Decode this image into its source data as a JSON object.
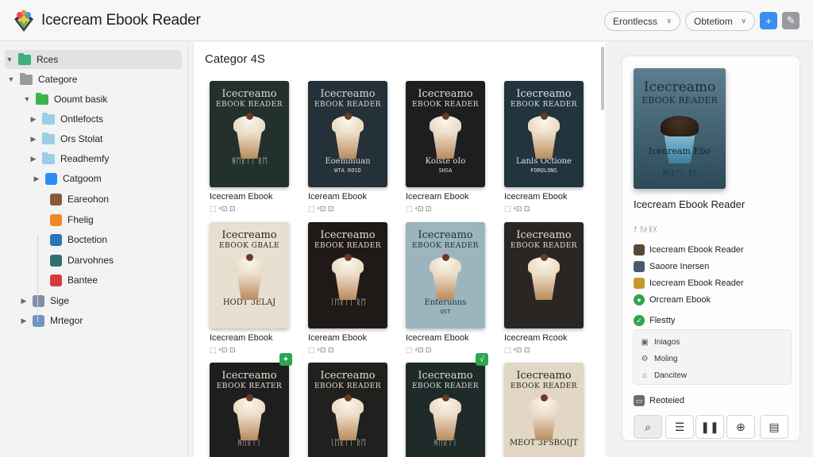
{
  "app": {
    "title": "Icecream Ebook Reader",
    "select_1": "Erontlecss",
    "select_2": "Obtetiom"
  },
  "sidebar": {
    "items": [
      {
        "label": "Rces",
        "depth": 0,
        "caret": "▼",
        "icon": "green-folder-icon",
        "color": "#3fae7a"
      },
      {
        "label": "Categore",
        "depth": 0,
        "caret": "▼",
        "icon": "category-folder-icon",
        "color": "#9a9a9e"
      },
      {
        "label": "Ooumt basik",
        "depth": 1,
        "caret": "▼",
        "icon": "green-folder-icon",
        "color": "#39b54a"
      },
      {
        "label": "Ontlefocts",
        "depth": 2,
        "caret": "▶",
        "icon": "folder-icon",
        "color": "#9dcde8"
      },
      {
        "label": "Ors Stolat",
        "depth": 2,
        "caret": "▶",
        "icon": "folder-icon",
        "color": "#9dcde8"
      },
      {
        "label": "Readhemfy",
        "depth": 2,
        "caret": "▶",
        "icon": "folder-icon",
        "color": "#9dcde8"
      },
      {
        "label": "Catgoom",
        "depth": 2,
        "caret": "▶",
        "icon": "grid-icon",
        "color": "#2d8cf0"
      },
      {
        "label": "Eareohon",
        "depth": 3,
        "caret": "",
        "icon": "book-icon",
        "color": "#8a5a3b"
      },
      {
        "label": "Fhelig",
        "depth": 3,
        "caret": "",
        "icon": "ticket-icon",
        "color": "#f08a24"
      },
      {
        "label": "Boctetion",
        "depth": 3,
        "caret": "",
        "icon": "window-icon",
        "color": "#2b77b8"
      },
      {
        "label": "Darvohnes",
        "depth": 3,
        "caret": "",
        "icon": "chart-icon",
        "color": "#2f6f74"
      },
      {
        "label": "Bantee",
        "depth": 3,
        "caret": "",
        "icon": "gift-icon",
        "color": "#d83a3a"
      },
      {
        "label": "Sige",
        "depth": 0,
        "caret": "▶",
        "icon": "image-icon",
        "color": "#7f8fa6"
      },
      {
        "label": "Mrtegor",
        "depth": 0,
        "caret": "▶",
        "icon": "frame-icon",
        "color": "#6f95c4"
      }
    ]
  },
  "main": {
    "title": "Categor 4S",
    "books": [
      {
        "cover_title": "Icecreamo",
        "cover_sub": "EBOOK READER",
        "cover_bottom": "ᚻᛖᚱᛏᛁ ᚱᛖ",
        "cover_bottom2": "",
        "title": "Icecream Ebook",
        "meta": "⬚ ⁴⊡ ⊡",
        "bg": "#22302e",
        "fg": "#d6dcc8",
        "badge": ""
      },
      {
        "cover_title": "Icecreamo",
        "cover_sub": "EBOOK READER",
        "cover_bottom": "Eoemmuan",
        "cover_bottom2": "WTA ROSD",
        "title": "Iceream Ebook",
        "meta": "⬚ ⁴⊡ ⊡",
        "bg": "#243138",
        "fg": "#d9dccf",
        "badge": ""
      },
      {
        "cover_title": "Icecreamo",
        "cover_sub": "EBOOK READER",
        "cover_bottom": "Kolste oIo",
        "cover_bottom2": "SHSA",
        "title": "Icecream Ebook",
        "meta": "⬚ ⁴⊡ ⊡",
        "bg": "#1c1e20",
        "fg": "#e2ddd0",
        "badge": ""
      },
      {
        "cover_title": "Icecreamo",
        "cover_sub": "EBOOK READER",
        "cover_bottom": "Lanls Octione",
        "cover_bottom2": "FOROLONS",
        "title": "Icecream Ebook",
        "meta": "⬚ ⁴⊡ ⊡",
        "bg": "#22343e",
        "fg": "#dbe2e2",
        "badge": ""
      },
      {
        "cover_title": "Icecreamo",
        "cover_sub": "EBOOK GBALE",
        "cover_bottom": "HODT 3ELAJ",
        "cover_bottom2": "",
        "title": "Icecream Ebook",
        "meta": "⬚ ⁴⊡ ⊡",
        "bg": "#e7dfcf",
        "fg": "#2a2520",
        "badge": ""
      },
      {
        "cover_title": "Icecreamo",
        "cover_sub": "EBOOK READER",
        "cover_bottom": "ᛁᛖᚱᛏᛁ ᚱᛖ",
        "cover_bottom2": "",
        "title": "Iceream Ebook",
        "meta": "⬚ ⁴⊡ ⊡",
        "bg": "#1f1a18",
        "fg": "#e6dccb",
        "badge": ""
      },
      {
        "cover_title": "Icecreamo",
        "cover_sub": "EBOOK READER",
        "cover_bottom": "Enterunus",
        "cover_bottom2": "UST",
        "title": "Icecream Ebook",
        "meta": "⬚ ⁴⊡ ⊡",
        "bg": "#9bb4bd",
        "fg": "#1f2d33",
        "badge": ""
      },
      {
        "cover_title": "Icecreamo",
        "cover_sub": "EBOOK READER",
        "cover_bottom": "",
        "cover_bottom2": "",
        "title": "Icecream Rcook",
        "meta": "⬚ ⁴⊡ ⊡",
        "bg": "#2a2624",
        "fg": "#e4ddd2",
        "badge": ""
      },
      {
        "cover_title": "Icecreamo",
        "cover_sub": "EBOOK REATER",
        "cover_bottom": "ᚻᛖᚱᛏᛁ",
        "cover_bottom2": "",
        "title": "",
        "meta": "",
        "bg": "#1e1e1e",
        "fg": "#e6ddd0",
        "badge": "✦"
      },
      {
        "cover_title": "Icecreamo",
        "cover_sub": "EBOOK READER",
        "cover_bottom": "ᛁᛖᚱᛏᛁ ᚱᛖ",
        "cover_bottom2": "",
        "title": "",
        "meta": "",
        "bg": "#20201e",
        "fg": "#e4dccb",
        "badge": ""
      },
      {
        "cover_title": "Icecreamo",
        "cover_sub": "EBOOK READER",
        "cover_bottom": "ᚻᛖᚱᛏᛁ",
        "cover_bottom2": "",
        "title": "",
        "meta": "",
        "bg": "#1f2a2a",
        "fg": "#d9ddd0",
        "badge": "√"
      },
      {
        "cover_title": "Icecreamo",
        "cover_sub": "EBOOK READER",
        "cover_bottom": "MEOT 3FSBOIJT",
        "cover_bottom2": "",
        "title": "",
        "meta": "",
        "bg": "#e2d7c5",
        "fg": "#2b2520",
        "badge": ""
      }
    ]
  },
  "details": {
    "cover_title": "Icecreamo",
    "cover_sub": "EBOOK READER",
    "cover_bottom": "Icenream Ebo",
    "cover_bottom2": "ᚻᛖᚱᛏᛁ ᚱᛖ",
    "title": "Icecream Ebook Reader",
    "meta": "ᚠ ᚢᚦᚱᚷ",
    "rows": [
      {
        "label": "Icecream Ebook Reader",
        "icon": "book-stack-icon",
        "color": "#5a4632"
      },
      {
        "label": "Saoore Inersen",
        "icon": "book-stack-icon",
        "color": "#4a5a6e"
      },
      {
        "label": "Icecream Ebook Reader",
        "icon": "book-stack-icon",
        "color": "#c49a2c"
      },
      {
        "label": "Orcream Ebook",
        "icon": "green-circle-icon",
        "color": "#2ea44f"
      },
      {
        "label": "Flestty",
        "icon": "green-check-icon",
        "color": "#2ea44f"
      }
    ],
    "box_rows": [
      {
        "label": "Iniagos",
        "icon": "calendar-icon",
        "glyph": "▣"
      },
      {
        "label": "Moling",
        "icon": "settings-icon",
        "glyph": "⚙"
      },
      {
        "label": "Dancitew",
        "icon": "home-icon",
        "glyph": "⌂"
      }
    ],
    "footer_label": "Reoteied",
    "toolbar": [
      {
        "name": "search-icon",
        "glyph": "⌕"
      },
      {
        "name": "list-icon",
        "glyph": "☰"
      },
      {
        "name": "pause-icon",
        "glyph": "❚❚"
      },
      {
        "name": "plus-circle-icon",
        "glyph": "⊕"
      },
      {
        "name": "note-icon",
        "glyph": "▤"
      }
    ]
  }
}
